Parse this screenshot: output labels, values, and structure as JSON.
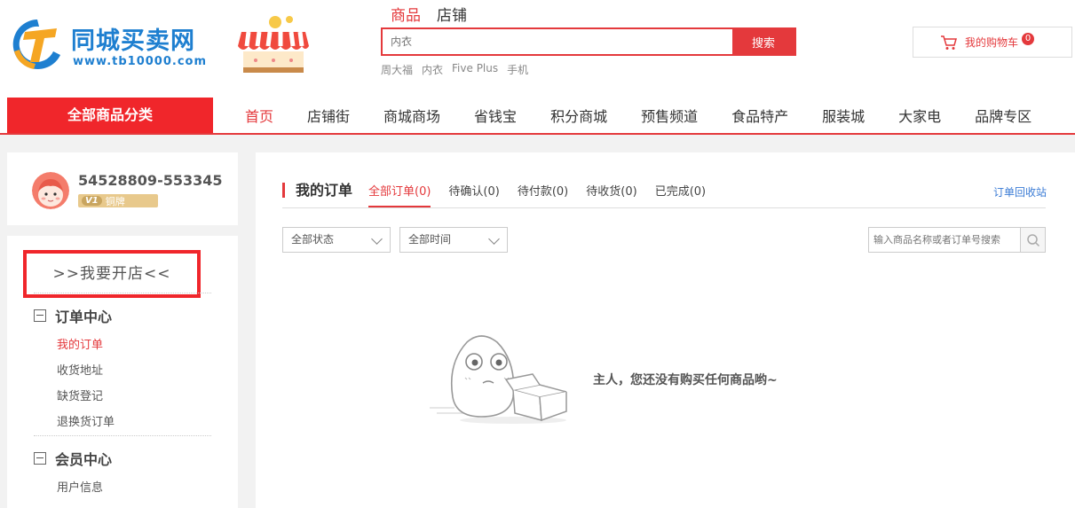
{
  "header": {
    "logo_text": "同城买卖网",
    "logo_url": "www.tb10000.com",
    "search_tabs": [
      "商品",
      "店铺"
    ],
    "search": {
      "value": "",
      "placeholder": "内衣",
      "button_label": "搜索"
    },
    "hot_words": [
      "周大福",
      "内衣",
      "Five Plus",
      "手机"
    ],
    "cart": {
      "label": "我的购物车",
      "count": "0"
    }
  },
  "nav": {
    "all_categories": "全部商品分类",
    "items": [
      "首页",
      "店铺街",
      "商城商场",
      "省钱宝",
      "积分商城",
      "预售频道",
      "食品特产",
      "服装城",
      "大家电",
      "品牌专区"
    ]
  },
  "user": {
    "name": "54528809-553345",
    "level_v": "V1",
    "level_label": "铜牌"
  },
  "sidebar": {
    "open_shop": ">>我要开店<<",
    "groups": [
      {
        "title": "订单中心",
        "items": [
          "我的订单",
          "收货地址",
          "缺货登记",
          "退换货订单"
        ]
      },
      {
        "title": "会员中心",
        "items": [
          "用户信息"
        ]
      }
    ]
  },
  "orders": {
    "title": "我的订单",
    "tabs": [
      "全部订单(0)",
      "待确认(0)",
      "待付款(0)",
      "待收货(0)",
      "已完成(0)"
    ],
    "recycle_link": "订单回收站",
    "status_filter": "全部状态",
    "time_filter": "全部时间",
    "search_placeholder": "输入商品名称或者订单号搜索",
    "empty_message": "主人，您还没有购买任何商品哟~"
  },
  "colors": {
    "accent": "#e4393c",
    "nav_red": "#f0262b",
    "link_blue": "#3a7bd5",
    "logo_blue": "#1e7fd0"
  },
  "icons": [
    "logo-icon",
    "shop-icon",
    "cart-icon",
    "search-icon",
    "chevron-down-icon",
    "toggle-minus-icon",
    "empty-box-icon"
  ]
}
